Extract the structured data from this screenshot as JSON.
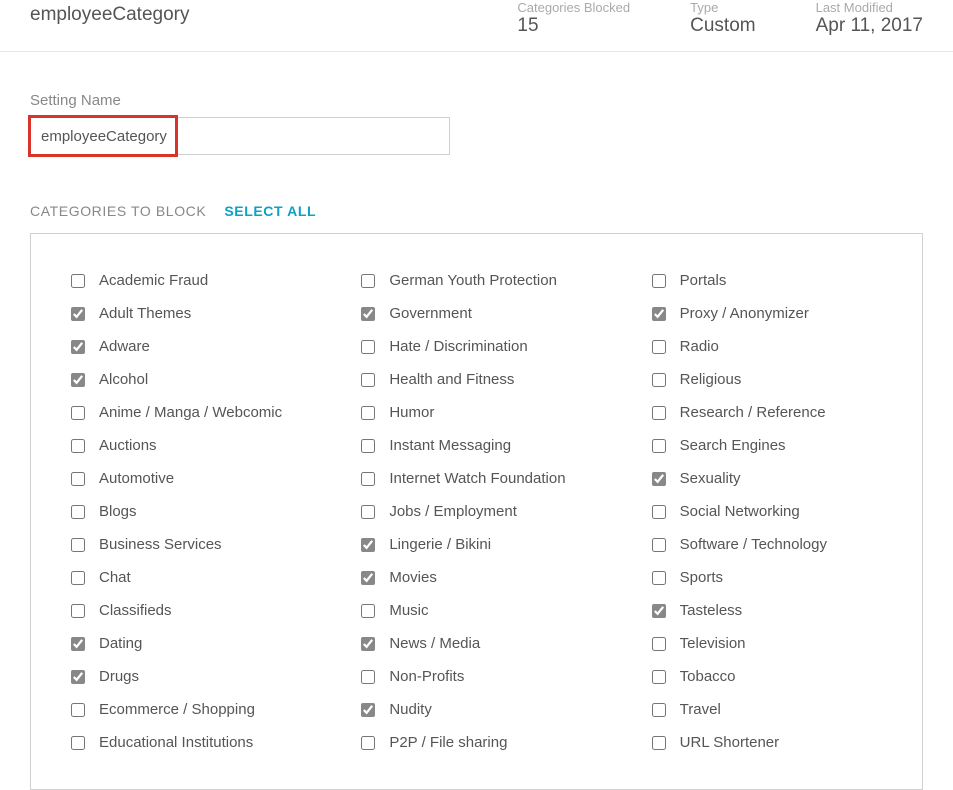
{
  "header": {
    "title": "employeeCategory",
    "summary": [
      {
        "label": "Categories Blocked",
        "value": "15"
      },
      {
        "label": "Type",
        "value": "Custom"
      },
      {
        "label": "Last Modified",
        "value": "Apr 11, 2017"
      }
    ]
  },
  "form": {
    "setting_name_label": "Setting Name",
    "setting_name_value": "employeeCategory"
  },
  "section": {
    "heading": "CATEGORIES TO BLOCK",
    "select_all": "SELECT ALL"
  },
  "categories": {
    "col1": [
      {
        "label": "Academic Fraud",
        "checked": false
      },
      {
        "label": "Adult Themes",
        "checked": true
      },
      {
        "label": "Adware",
        "checked": true
      },
      {
        "label": "Alcohol",
        "checked": true
      },
      {
        "label": "Anime / Manga / Webcomic",
        "checked": false
      },
      {
        "label": "Auctions",
        "checked": false
      },
      {
        "label": "Automotive",
        "checked": false
      },
      {
        "label": "Blogs",
        "checked": false
      },
      {
        "label": "Business Services",
        "checked": false
      },
      {
        "label": "Chat",
        "checked": false
      },
      {
        "label": "Classifieds",
        "checked": false
      },
      {
        "label": "Dating",
        "checked": true
      },
      {
        "label": "Drugs",
        "checked": true
      },
      {
        "label": "Ecommerce / Shopping",
        "checked": false
      },
      {
        "label": "Educational Institutions",
        "checked": false
      }
    ],
    "col2": [
      {
        "label": "German Youth Protection",
        "checked": false
      },
      {
        "label": "Government",
        "checked": true
      },
      {
        "label": "Hate / Discrimination",
        "checked": false
      },
      {
        "label": "Health and Fitness",
        "checked": false
      },
      {
        "label": "Humor",
        "checked": false
      },
      {
        "label": "Instant Messaging",
        "checked": false
      },
      {
        "label": "Internet Watch Foundation",
        "checked": false
      },
      {
        "label": "Jobs / Employment",
        "checked": false
      },
      {
        "label": "Lingerie / Bikini",
        "checked": true
      },
      {
        "label": "Movies",
        "checked": true
      },
      {
        "label": "Music",
        "checked": false
      },
      {
        "label": "News / Media",
        "checked": true
      },
      {
        "label": "Non-Profits",
        "checked": false
      },
      {
        "label": "Nudity",
        "checked": true
      },
      {
        "label": "P2P / File sharing",
        "checked": false
      }
    ],
    "col3": [
      {
        "label": "Portals",
        "checked": false
      },
      {
        "label": "Proxy / Anonymizer",
        "checked": true
      },
      {
        "label": "Radio",
        "checked": false
      },
      {
        "label": "Religious",
        "checked": false
      },
      {
        "label": "Research / Reference",
        "checked": false
      },
      {
        "label": "Search Engines",
        "checked": false
      },
      {
        "label": "Sexuality",
        "checked": true
      },
      {
        "label": "Social Networking",
        "checked": false
      },
      {
        "label": "Software / Technology",
        "checked": false
      },
      {
        "label": "Sports",
        "checked": false
      },
      {
        "label": "Tasteless",
        "checked": true
      },
      {
        "label": "Television",
        "checked": false
      },
      {
        "label": "Tobacco",
        "checked": false
      },
      {
        "label": "Travel",
        "checked": false
      },
      {
        "label": "URL Shortener",
        "checked": false
      }
    ]
  }
}
